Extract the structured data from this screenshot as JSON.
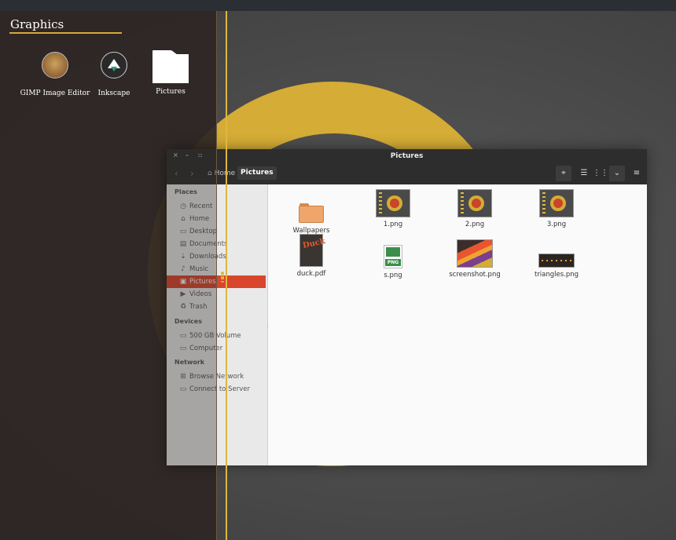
{
  "dash": {
    "category_title": "Graphics",
    "apps": [
      {
        "label": "GIMP Image Editor",
        "icon": "gimp-icon"
      },
      {
        "label": "Inkscape",
        "icon": "inkscape-icon"
      },
      {
        "label": "Pictures",
        "icon": "folder-icon"
      }
    ]
  },
  "window": {
    "title": "Pictures",
    "controls": {
      "close": "×",
      "minimize": "–",
      "maximize": "▫"
    },
    "nav": {
      "back": "‹",
      "forward": "›"
    },
    "breadcrumb": {
      "home": "Home",
      "current": "Pictures"
    },
    "toolbar": {
      "locate": "⌖",
      "list_view": "☰",
      "grid_view": "⋮⋮",
      "view_options": "⌄",
      "menu": "≡"
    }
  },
  "sidebar": {
    "sections": [
      {
        "title": "Places",
        "items": [
          {
            "label": "Recent",
            "icon": "◷"
          },
          {
            "label": "Home",
            "icon": "⌂"
          },
          {
            "label": "Desktop",
            "icon": "▭"
          },
          {
            "label": "Documents",
            "icon": "▤"
          },
          {
            "label": "Downloads",
            "icon": "⇣"
          },
          {
            "label": "Music",
            "icon": "♪"
          },
          {
            "label": "Pictures",
            "icon": "▣",
            "selected": true
          },
          {
            "label": "Videos",
            "icon": "▶"
          },
          {
            "label": "Trash",
            "icon": "♻"
          }
        ]
      },
      {
        "title": "Devices",
        "items": [
          {
            "label": "500 GB Volume",
            "icon": "▭"
          },
          {
            "label": "Computer",
            "icon": "▭"
          }
        ]
      },
      {
        "title": "Network",
        "items": [
          {
            "label": "Browse Network",
            "icon": "⊞"
          },
          {
            "label": "Connect to Server",
            "icon": "▭"
          }
        ]
      }
    ]
  },
  "files": [
    {
      "name": "Wallpapers",
      "kind": "folder"
    },
    {
      "name": "1.png",
      "kind": "image"
    },
    {
      "name": "2.png",
      "kind": "image"
    },
    {
      "name": "3.png",
      "kind": "image"
    },
    {
      "name": "duck.pdf",
      "kind": "pdf",
      "thumb_text": "Duck"
    },
    {
      "name": "s.png",
      "kind": "png-icon",
      "thumb_text": "PNG"
    },
    {
      "name": "screenshot.png",
      "kind": "image"
    },
    {
      "name": "triangles.png",
      "kind": "image"
    }
  ],
  "colors": {
    "accent": "#d4ac36",
    "selection": "#d9452c",
    "titlebar": "#2d2d2d"
  }
}
